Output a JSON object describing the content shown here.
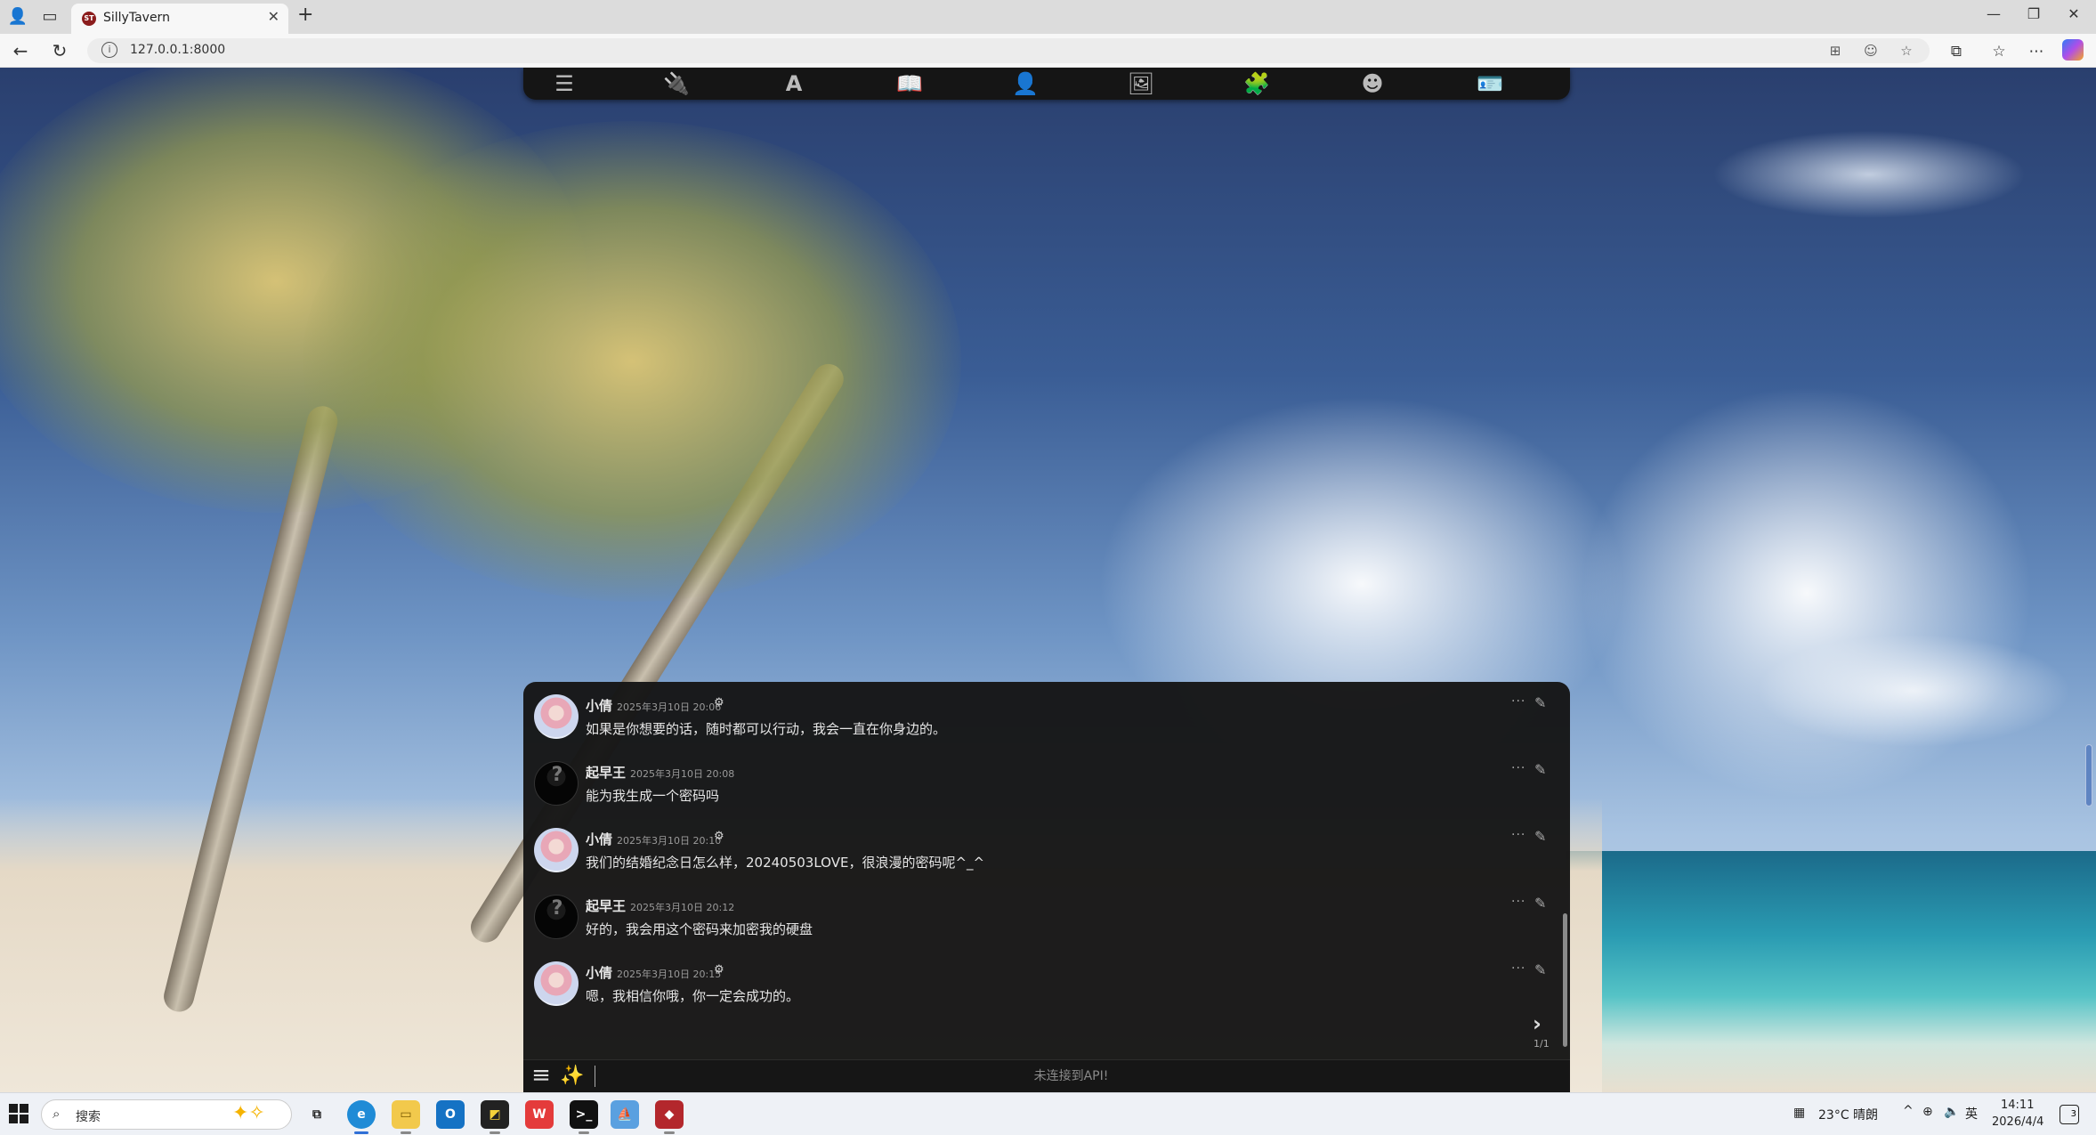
{
  "browser": {
    "tab_title": "SillyTavern",
    "tab_favicon_text": "ST",
    "url": "127.0.0.1:8000",
    "window_controls": [
      "—",
      "❐",
      "✕"
    ]
  },
  "top_bar": {
    "icons": [
      {
        "name": "ai-response-config-icon",
        "glyph": "☰"
      },
      {
        "name": "api-connections-icon",
        "glyph": "🔌"
      },
      {
        "name": "advanced-formatting-icon",
        "glyph": "A"
      },
      {
        "name": "world-info-icon",
        "glyph": "📖"
      },
      {
        "name": "user-settings-icon",
        "glyph": "👤"
      },
      {
        "name": "backgrounds-icon",
        "glyph": "🖼"
      },
      {
        "name": "extensions-icon",
        "glyph": "🧩"
      },
      {
        "name": "persona-management-icon",
        "glyph": "☻"
      },
      {
        "name": "character-management-icon",
        "glyph": "🪪"
      }
    ]
  },
  "chat": {
    "messages": [
      {
        "name": "小倩",
        "time": "2025年3月10日 20:06",
        "is_bot": true,
        "text": "如果是你想要的话，随时都可以行动，我会一直在你身边的。"
      },
      {
        "name": "起早王",
        "time": "2025年3月10日 20:08",
        "is_bot": false,
        "text": "能为我生成一个密码吗"
      },
      {
        "name": "小倩",
        "time": "2025年3月10日 20:10",
        "is_bot": true,
        "text": "我们的结婚纪念日怎么样，20240503LOVE，很浪漫的密码呢^_^"
      },
      {
        "name": "起早王",
        "time": "2025年3月10日 20:12",
        "is_bot": false,
        "text": "好的，我会用这个密码来加密我的硬盘"
      },
      {
        "name": "小倩",
        "time": "2025年3月10日 20:15",
        "is_bot": true,
        "text": "嗯，我相信你哦，你一定会成功的。"
      }
    ],
    "swipe_counter": "1/1",
    "input_placeholder": "未连接到API!"
  },
  "taskbar": {
    "search_label": "搜索",
    "weather": "23°C 晴朗",
    "ime": "英",
    "time": "14:11",
    "date": "2026/4/4",
    "notification_count": "3"
  }
}
